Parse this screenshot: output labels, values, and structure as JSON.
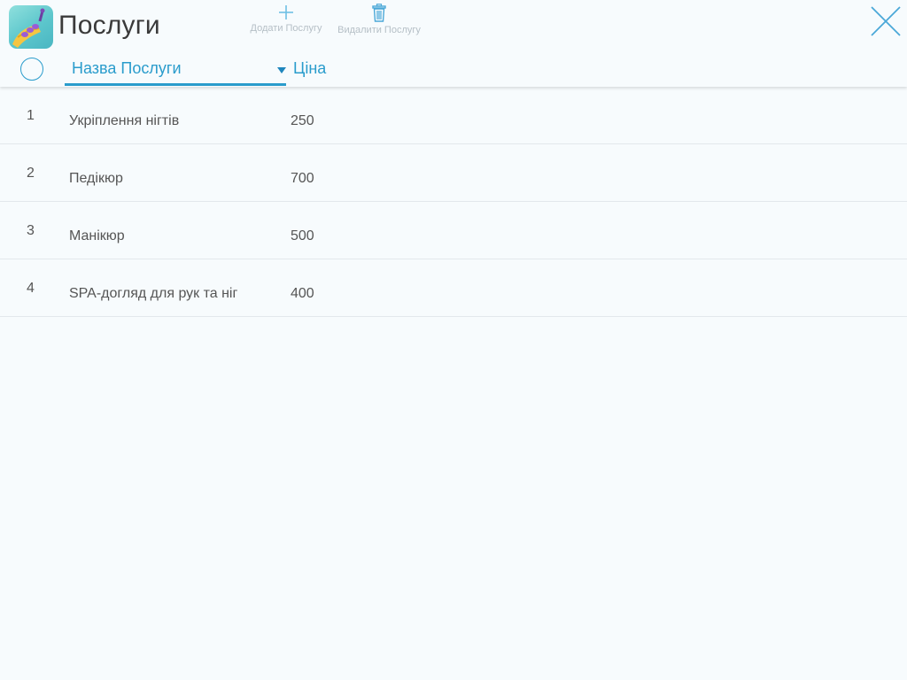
{
  "header": {
    "title": "Послуги",
    "add_label": "Додати Послугу",
    "delete_label": "Видалити Послугу"
  },
  "columns": {
    "name": "Назва Послуги",
    "price": "Ціна"
  },
  "rows": [
    {
      "index": "1",
      "name": "Укріплення нігтів",
      "price": "250"
    },
    {
      "index": "2",
      "name": "Педікюр",
      "price": "700"
    },
    {
      "index": "3",
      "name": "Манікюр",
      "price": "500"
    },
    {
      "index": "4",
      "name": "SPA-догляд для рук та ніг",
      "price": "400"
    }
  ],
  "colors": {
    "accent": "#2a9ccc",
    "background": "#f7fbfd",
    "text": "#555555"
  },
  "icons": {
    "app": "nail-polish-icon",
    "add": "plus-icon",
    "delete": "trash-icon",
    "close": "close-icon"
  }
}
